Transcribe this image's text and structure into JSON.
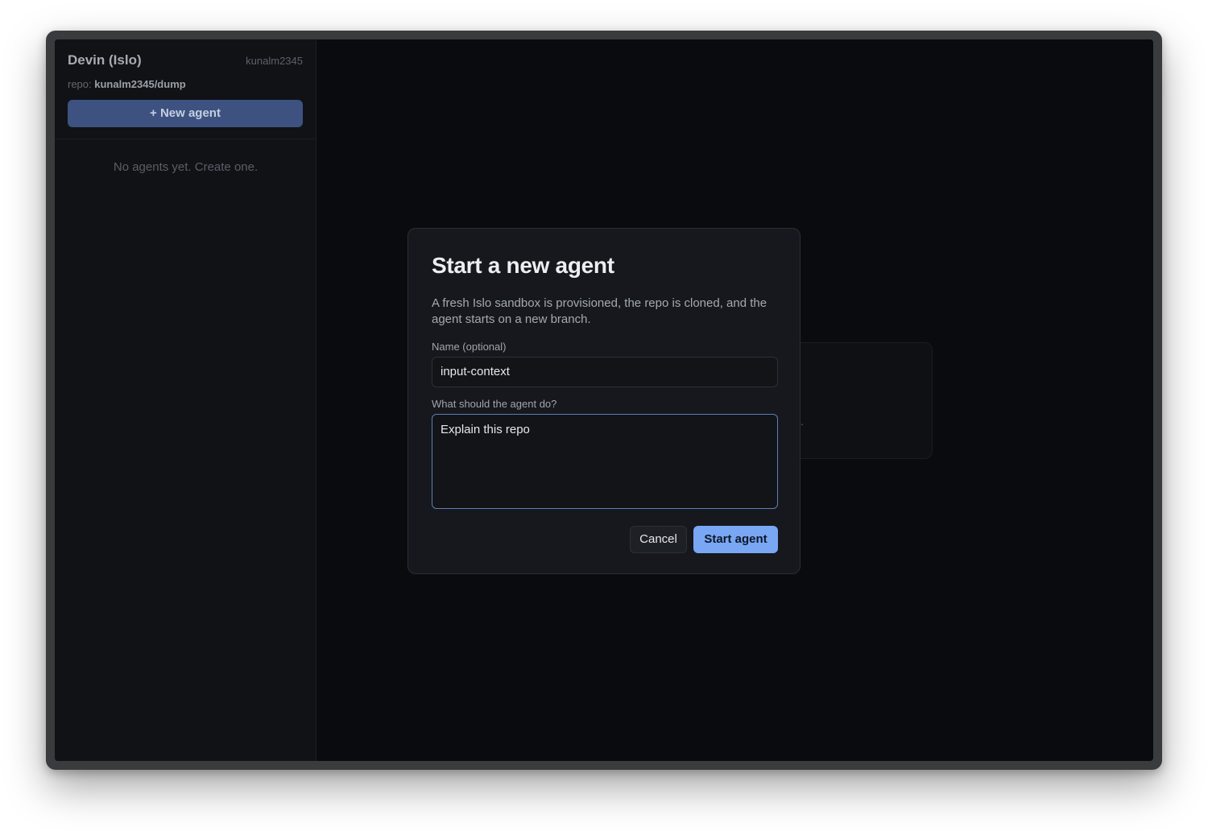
{
  "sidebar": {
    "app_title": "Devin (Islo)",
    "username": "kunalm2345",
    "repo_prefix": "repo:",
    "repo_name": "kunalm2345/dump",
    "new_agent_label": "+ New agent",
    "empty_message": "No agents yet. Create one."
  },
  "background": {
    "trailing_dot": "."
  },
  "modal": {
    "title": "Start a new agent",
    "description": "A fresh Islo sandbox is provisioned, the repo is cloned, and the agent starts on a new branch.",
    "name_label": "Name (optional)",
    "name_value": "input-context",
    "task_label": "What should the agent do?",
    "task_value": "Explain this repo",
    "cancel_label": "Cancel",
    "start_label": "Start agent"
  },
  "colors": {
    "accent": "#79a7f4",
    "new_agent_button": "#3d5280",
    "background": "#0a0b0e",
    "modal_background": "#16181d"
  }
}
